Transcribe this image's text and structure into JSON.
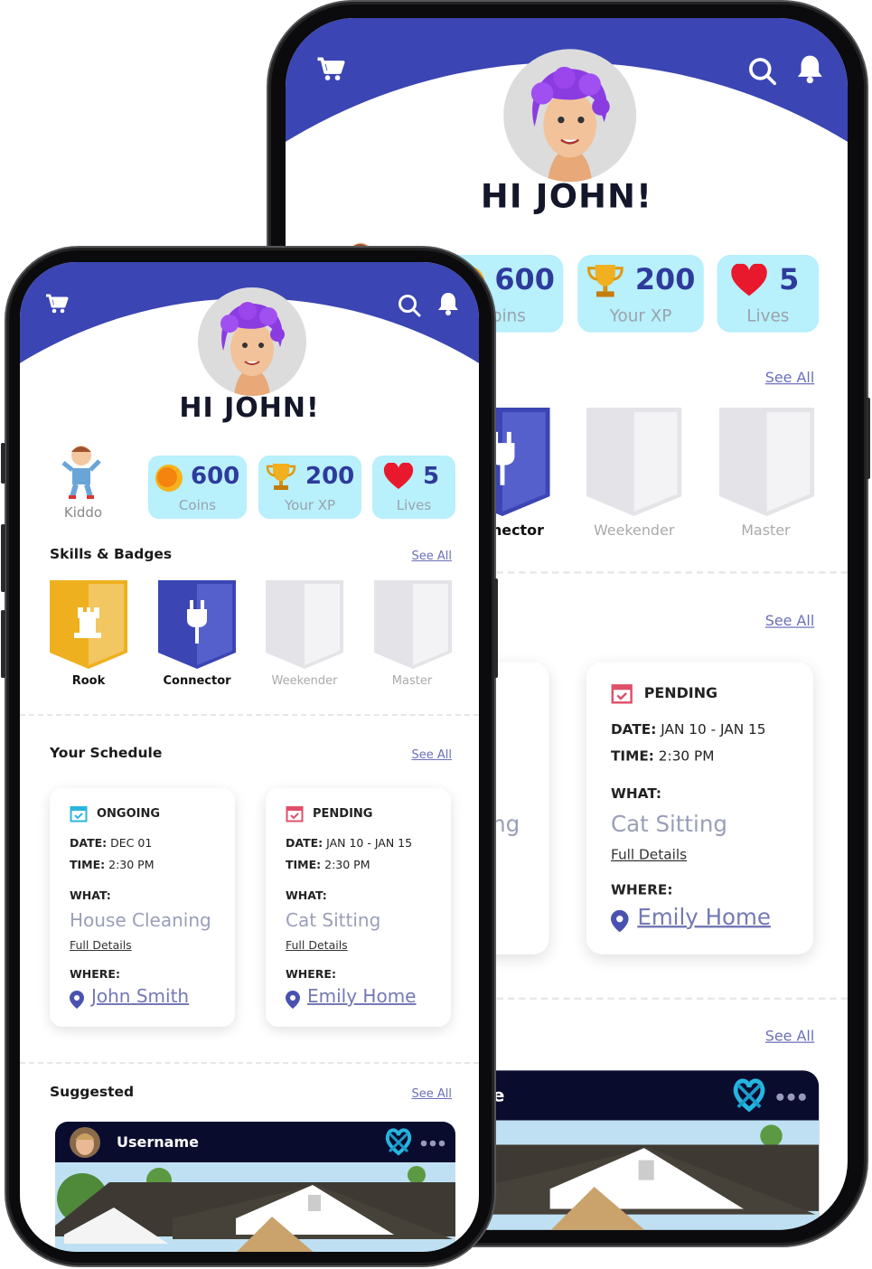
{
  "header": {
    "greeting": "HI JOHN!",
    "icons": [
      "cart-icon",
      "search-icon",
      "bell-icon"
    ],
    "color": "#3b45b3"
  },
  "profile": {
    "level_label": "Kiddo"
  },
  "stats": [
    {
      "value": "600",
      "label": "Coins",
      "icon": "coin-icon"
    },
    {
      "value": "200",
      "label": "Your XP",
      "icon": "trophy-icon"
    },
    {
      "value": "5",
      "label": "Lives",
      "icon": "heart-icon"
    }
  ],
  "skills": {
    "title": "Skills & Badges",
    "see_all": "See All",
    "badges": [
      {
        "label": "Rook",
        "earned": true,
        "color": "#eeb01e"
      },
      {
        "label": "Connector",
        "earned": true,
        "color": "#3b45b3"
      },
      {
        "label": "Weekender",
        "earned": false
      },
      {
        "label": "Master",
        "earned": false
      }
    ]
  },
  "schedule": {
    "title": "Your Schedule",
    "see_all": "See All",
    "date_label": "DATE:",
    "time_label": "TIME:",
    "what_label": "WHAT:",
    "where_label": "WHERE:",
    "details_label": "Full Details",
    "items": [
      {
        "status": "ONGOING",
        "status_color": "#2bb6de",
        "date": "DEC 01",
        "time": "2:30 PM",
        "what": "House Cleaning",
        "where": "John Smith"
      },
      {
        "status": "PENDING",
        "status_color": "#e0506a",
        "date": "JAN 10 - JAN 15",
        "time": "2:30 PM",
        "what": "Cat Sitting",
        "where": "Emily Home"
      }
    ]
  },
  "suggested": {
    "title": "Suggested",
    "see_all": "See All",
    "post": {
      "username": "Username"
    }
  }
}
